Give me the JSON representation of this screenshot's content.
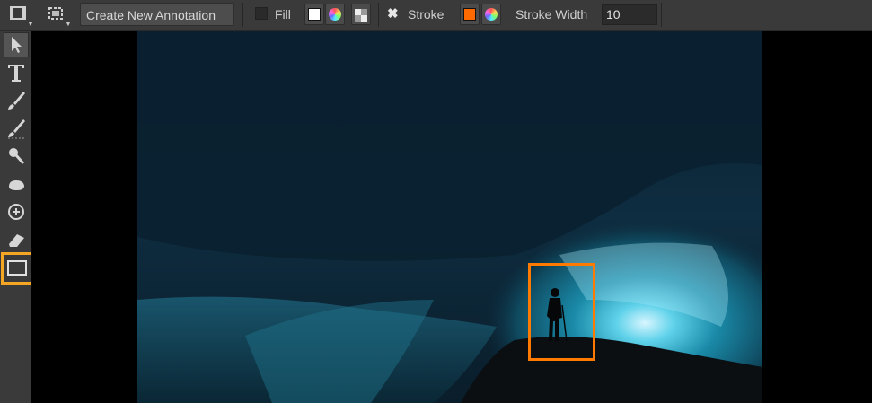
{
  "toolbar": {
    "viewer_mode_icon": "film-frame-icon",
    "selection_mode_icon": "frame-select-icon",
    "create_annotation_label": "Create New Annotation",
    "fill_label": "Fill",
    "fill_checked": false,
    "fill_color": "#ffffff",
    "stroke_label": "Stroke",
    "stroke_checked": true,
    "stroke_color": "#ff6a00",
    "stroke_width_label": "Stroke Width",
    "stroke_width_value": "10"
  },
  "tools": [
    {
      "name": "select-tool",
      "icon": "arrow-cursor-icon"
    },
    {
      "name": "text-tool",
      "icon": "text-t-icon"
    },
    {
      "name": "paint-brush-tool",
      "icon": "brush-icon"
    },
    {
      "name": "brush-eraser-tool",
      "icon": "soft-brush-icon"
    },
    {
      "name": "clone-tool",
      "icon": "magnifier-icon"
    },
    {
      "name": "smudge-tool",
      "icon": "blob-icon"
    },
    {
      "name": "dodge-tool",
      "icon": "circle-plus-icon"
    },
    {
      "name": "eraser-tool",
      "icon": "eraser-icon"
    },
    {
      "name": "shape-tool",
      "icon": "rectangle-icon",
      "active": true
    }
  ],
  "shape_flyout": [
    "arrow-shape-icon",
    "rectangle-shape-icon"
  ],
  "annotation": {
    "stroke_color": "#ff7a00"
  }
}
